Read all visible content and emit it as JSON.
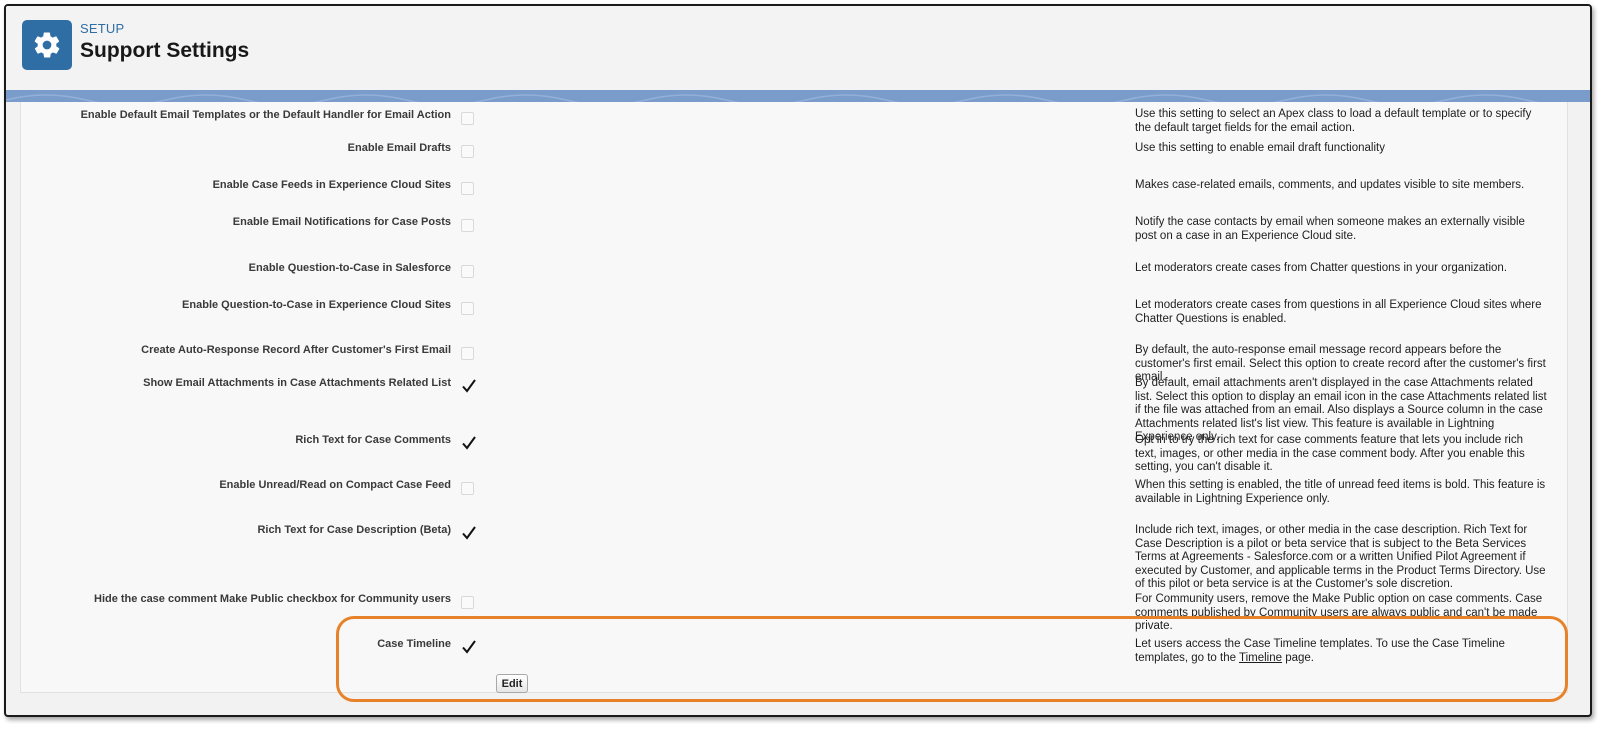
{
  "header": {
    "setup_label": "SETUP",
    "title": "Support Settings",
    "icon": "gear-icon",
    "icon_bg": "#2f6ea5"
  },
  "settings": [
    {
      "label": "Enable Default Email Templates or the Default Handler for Email Action",
      "checked": false,
      "description": "Use this setting to select an Apex class to load a default template or to specify the default target fields for the email action."
    },
    {
      "label": "Enable Email Drafts",
      "checked": false,
      "description": "Use this setting to enable email draft functionality"
    },
    {
      "label": "Enable Case Feeds in Experience Cloud Sites",
      "checked": false,
      "description": "Makes case-related emails, comments, and updates visible to site members."
    },
    {
      "label": "Enable Email Notifications for Case Posts",
      "checked": false,
      "description": "Notify the case contacts by email when someone makes an externally visible post on a case in an Experience Cloud site."
    },
    {
      "label": "Enable Question-to-Case in Salesforce",
      "checked": false,
      "description": "Let moderators create cases from Chatter questions in your organization."
    },
    {
      "label": "Enable Question-to-Case in Experience Cloud Sites",
      "checked": false,
      "description": "Let moderators create cases from questions in all Experience Cloud sites where Chatter Questions is enabled."
    },
    {
      "label": "Create Auto-Response Record After Customer's First Email",
      "checked": false,
      "description": "By default, the auto-response email message record appears before the customer's first email. Select this option to create record after the customer's first email."
    },
    {
      "label": "Show Email Attachments in Case Attachments Related List",
      "checked": true,
      "description": "By default, email attachments aren't displayed in the case Attachments related list. Select this option to display an email icon in the case Attachments related list if the file was attached from an email. Also displays a Source column in the case Attachments related list's list view. This feature is available in Lightning Experience only."
    },
    {
      "label": "Rich Text for Case Comments",
      "checked": true,
      "description": "Opt in to try the rich text for case comments feature that lets you include rich text, images, or other media in the case comment body. After you enable this setting, you can't disable it."
    },
    {
      "label": "Enable Unread/Read on Compact Case Feed",
      "checked": false,
      "description": "When this setting is enabled, the title of unread feed items is bold. This feature is available in Lightning Experience only."
    },
    {
      "label": "Rich Text for Case Description (Beta)",
      "checked": true,
      "description": "Include rich text, images, or other media in the case description. Rich Text for Case Description is a pilot or beta service that is subject to the Beta Services Terms at Agreements - Salesforce.com or a written Unified Pilot Agreement if executed by Customer, and applicable terms in the Product Terms Directory. Use of this pilot or beta service is at the Customer's sole discretion."
    },
    {
      "label": "Hide the case comment Make Public checkbox for Community users",
      "checked": false,
      "description": "For Community users, remove the Make Public option on case comments. Case comments published by Community users are always public and can't be made private."
    },
    {
      "label": "Case Timeline",
      "checked": true,
      "description": "Let users access the Case Timeline templates. To use the Case Timeline templates, go to the ",
      "link_text": "Timeline",
      "description_after": " page."
    }
  ],
  "edit_button_label": "Edit",
  "colors": {
    "accent_blue": "#2f6ea5",
    "highlight_orange": "#e8822a",
    "band_blue": "#7a9ccb"
  }
}
